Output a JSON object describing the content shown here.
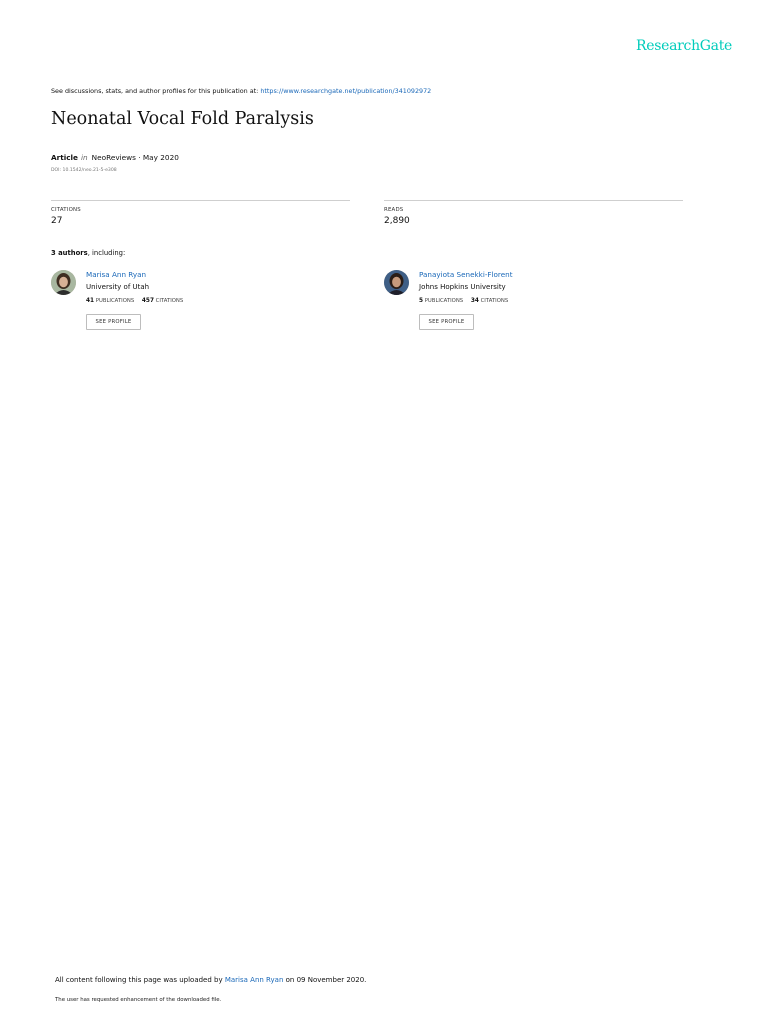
{
  "brand": "ResearchGate",
  "see_line": {
    "prefix": "See discussions, stats, and author profiles for this publication at: ",
    "url": "https://www.researchgate.net/publication/341092972"
  },
  "title": "Neonatal Vocal Fold Paralysis",
  "meta": {
    "type": "Article",
    "in": "in",
    "journal": "NeoReviews · May 2020",
    "doi": "DOI: 10.1542/neo.21-5-e308"
  },
  "stats": [
    {
      "label": "CITATIONS",
      "value": "27"
    },
    {
      "label": "READS",
      "value": "2,890"
    }
  ],
  "authors_heading": {
    "count": "3 authors",
    "suffix": ", including:"
  },
  "authors": [
    {
      "name": "Marisa Ann Ryan",
      "institution": "University of Utah",
      "publications": "41",
      "publications_label": "PUBLICATIONS",
      "citations": "457",
      "citations_label": "CITATIONS",
      "button": "SEE PROFILE"
    },
    {
      "name": "Panayiota Senekki-Florent",
      "institution": "Johns Hopkins University",
      "publications": "5",
      "publications_label": "PUBLICATIONS",
      "citations": "34",
      "citations_label": "CITATIONS",
      "button": "SEE PROFILE"
    }
  ],
  "footer": {
    "prefix": "All content following this page was uploaded by ",
    "uploader": "Marisa Ann Ryan",
    "suffix": " on 09 November 2020.",
    "note": "The user has requested enhancement of the downloaded file."
  },
  "colors": {
    "brand": "#00ccbb",
    "link": "#1a68b8",
    "rule": "#cfcfcf"
  }
}
